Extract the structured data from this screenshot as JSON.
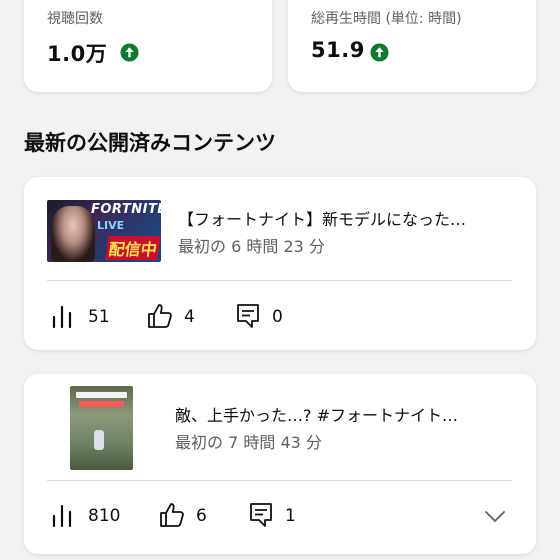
{
  "stats": [
    {
      "label": "視聴回数",
      "value": "1.0万",
      "trend": "up"
    },
    {
      "label": "総再生時間 (単位: 時間)",
      "value": "51.9",
      "trend": "up"
    }
  ],
  "section": {
    "title": "最新の公開済みコンテンツ"
  },
  "videos": [
    {
      "title": "【フォートナイト】新モデルになった…",
      "subtitle": "最初の 6 時間 23 分",
      "views": "51",
      "likes": "4",
      "comments": "0",
      "thumb_text_1": "FORTNITE",
      "thumb_text_2": "LIVE",
      "thumb_text_3": "配信中"
    },
    {
      "title": "敵、上手かった…? #フォートナイト…",
      "subtitle": "最初の 7 時間 43 分",
      "views": "810",
      "likes": "6",
      "comments": "1"
    }
  ],
  "icons": {
    "trend": "arrow-up-circle-icon",
    "views": "bar-chart-icon",
    "likes": "thumbs-up-icon",
    "comments": "comment-icon",
    "expand": "chevron-down-icon"
  },
  "colors": {
    "trend_up": "#0f7a2e",
    "background": "#f2f2f2",
    "card": "#ffffff",
    "muted_text": "#606060"
  }
}
